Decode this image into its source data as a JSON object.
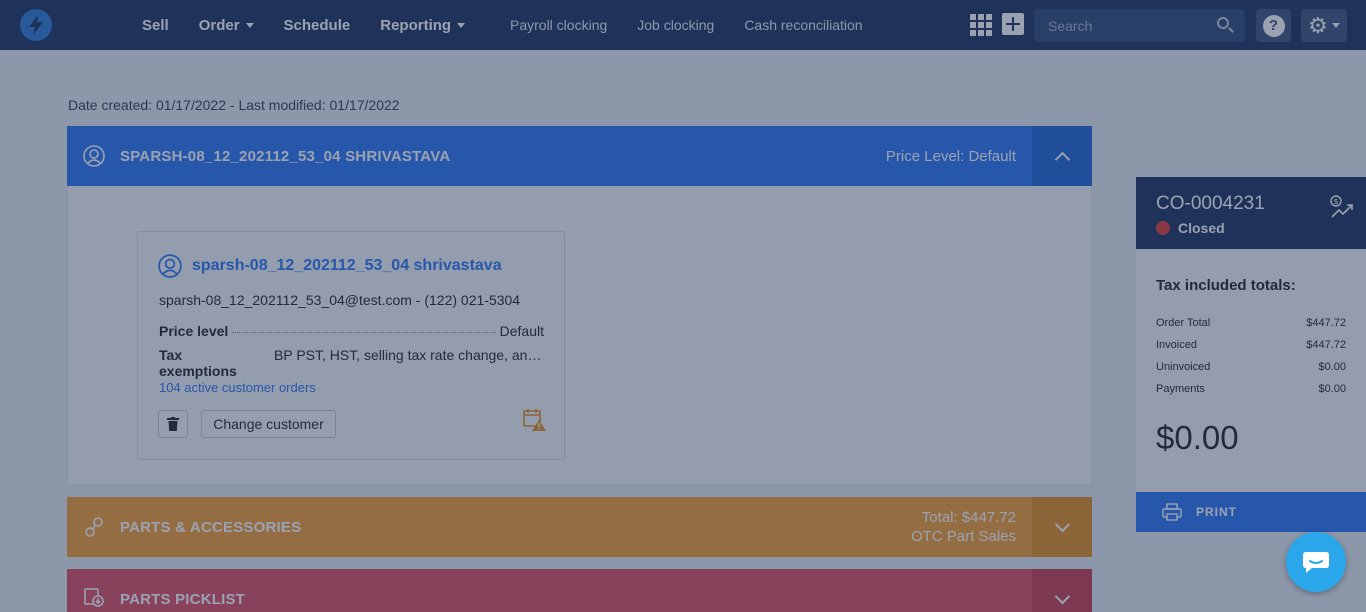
{
  "nav": {
    "main": [
      {
        "label": "Sell",
        "dropdown": false
      },
      {
        "label": "Order",
        "dropdown": true
      },
      {
        "label": "Schedule",
        "dropdown": false
      },
      {
        "label": "Reporting",
        "dropdown": true
      }
    ],
    "sub": [
      {
        "label": "Payroll clocking"
      },
      {
        "label": "Job clocking"
      },
      {
        "label": "Cash reconciliation"
      }
    ],
    "search_placeholder": "Search",
    "help_label": "?"
  },
  "page": {
    "date_line": "Date created: 01/17/2022 - Last modified: 01/17/2022"
  },
  "customer_section": {
    "title": "SPARSH-08_12_202112_53_04 SHRIVASTAVA",
    "price_level_label": "Price Level: Default",
    "card": {
      "name": "sparsh-08_12_202112_53_04 shrivastava",
      "contact": "sparsh-08_12_202112_53_04@test.com - (122) 021-5304",
      "price_level_key": "Price level",
      "price_level_value": "Default",
      "tax_key": "Tax exemptions",
      "tax_value": "BP PST, HST, selling tax rate change, another",
      "active_orders": "104 active customer orders",
      "change_label": "Change customer"
    }
  },
  "parts_section": {
    "title": "PARTS & ACCESSORIES",
    "total": "Total: $447.72",
    "subtitle": "OTC Part Sales"
  },
  "picklist_section": {
    "title": "PARTS PICKLIST"
  },
  "side_panel": {
    "order_number": "CO-0004231",
    "status": "Closed",
    "tax_heading": "Tax included totals:",
    "totals": [
      {
        "label": "Order Total",
        "value": "$447.72"
      },
      {
        "label": "Invoiced",
        "value": "$447.72"
      },
      {
        "label": "Uninvoiced",
        "value": "$0.00"
      },
      {
        "label": "Payments",
        "value": "$0.00"
      }
    ],
    "big_amount": "$0.00",
    "print_label": "PRINT"
  },
  "colors": {
    "nav_bg": "#2c3f66",
    "customer_header": "#3a7ff2",
    "parts_header": "#f4a53e",
    "picklist_header": "#e25b6b",
    "status_closed": "#e04848",
    "chat_button": "#2aa7ea"
  },
  "icons": {
    "logo": "lightning-logo-icon",
    "apps": "apps-grid-icon",
    "add": "plus-icon",
    "search": "search-icon",
    "help": "help-icon",
    "settings": "gear-icon",
    "customer": "customer-icon",
    "parts": "parts-icon",
    "picklist": "picklist-icon",
    "trash": "trash-icon",
    "calendar_warning": "calendar-warning-icon",
    "trend": "price-trend-icon",
    "print": "printer-icon",
    "chat": "chat-icon"
  }
}
